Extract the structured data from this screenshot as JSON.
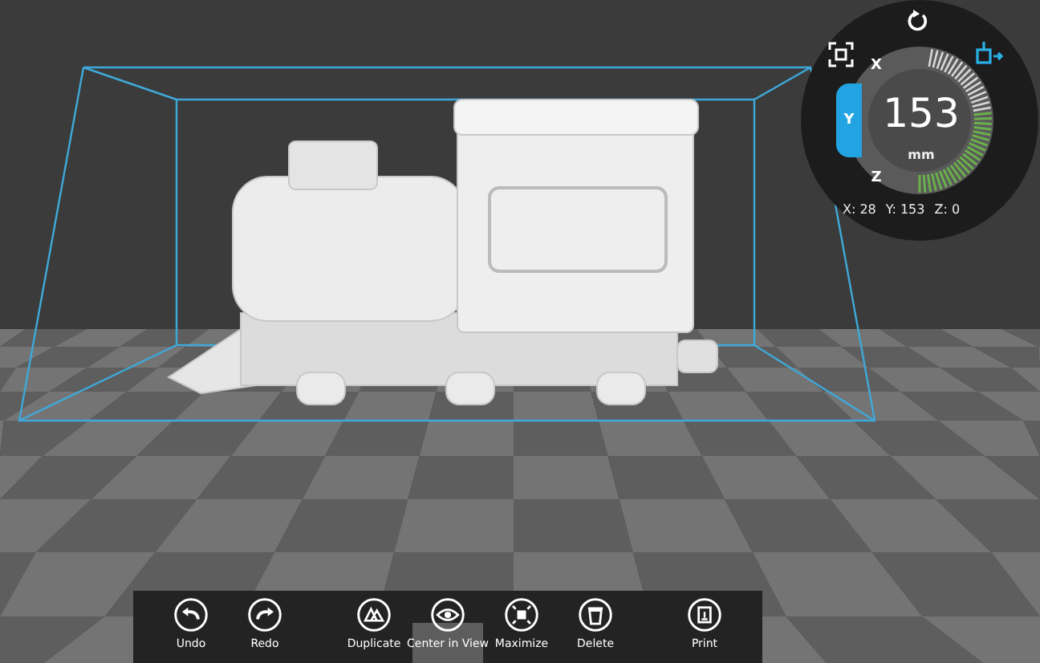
{
  "dial": {
    "value": "153",
    "unit": "mm",
    "level": 0.58,
    "axes": [
      {
        "label": "X",
        "selected": false
      },
      {
        "label": "Y",
        "selected": true
      },
      {
        "label": "Z",
        "selected": false
      }
    ],
    "readings": [
      {
        "label": "X:",
        "value": "28"
      },
      {
        "label": "Y:",
        "value": "153"
      },
      {
        "label": "Z:",
        "value": "0"
      }
    ]
  },
  "toolbar": [
    {
      "label": "Undo",
      "kind": "undo",
      "highlighted": false
    },
    {
      "label": "Redo",
      "kind": "redo",
      "highlighted": false
    },
    {
      "label": "Duplicate",
      "kind": "duplicate",
      "highlighted": false
    },
    {
      "label": "Center in View",
      "kind": "center",
      "highlighted": true
    },
    {
      "label": "Maximize",
      "kind": "maximize",
      "highlighted": false
    },
    {
      "label": "Delete",
      "kind": "delete",
      "highlighted": false
    },
    {
      "label": "Print",
      "kind": "print",
      "highlighted": false
    }
  ]
}
